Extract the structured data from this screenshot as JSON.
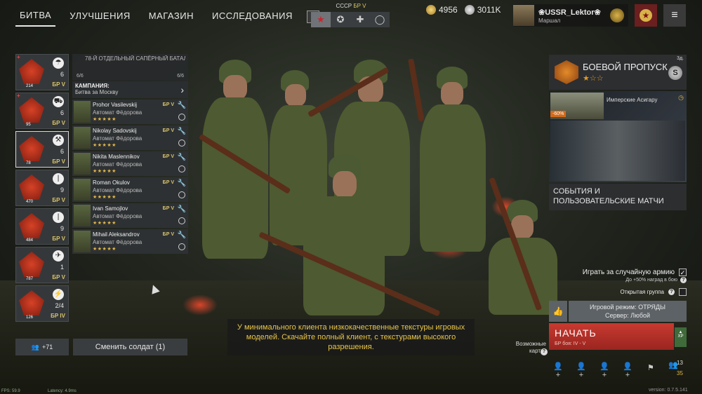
{
  "nav": {
    "tabs": [
      "БИТВА",
      "УЛУЧШЕНИЯ",
      "МАГАЗИН",
      "ИССЛЕДОВАНИЯ"
    ],
    "help": "?"
  },
  "nation": {
    "name": "СССР",
    "br": "БР V",
    "tabs": [
      "★",
      "✪",
      "✚",
      "◯"
    ]
  },
  "currency": {
    "gold": "4956",
    "silver": "3011K"
  },
  "profile": {
    "name": "❀USSR_Lektor❀",
    "rank": "Маршал"
  },
  "menu_icon": "≡",
  "squads": [
    {
      "num": "214",
      "class_icon": "parachute-icon",
      "class_glyph": "☂",
      "count": "6",
      "br": "БР V",
      "plus": "+"
    },
    {
      "num": "95",
      "class_icon": "tank-icon",
      "class_glyph": "⛟",
      "count": "6",
      "br": "БР V",
      "plus": "+"
    },
    {
      "num": "78",
      "class_icon": "engineer-icon",
      "class_glyph": "⚒",
      "count": "6",
      "br": "БР V",
      "plus": ""
    },
    {
      "num": "470",
      "class_icon": "bayonet-icon",
      "class_glyph": "|",
      "count": "9",
      "br": "БР V",
      "plus": ""
    },
    {
      "num": "484",
      "class_icon": "bayonet-icon",
      "class_glyph": "|",
      "count": "9",
      "br": "БР V",
      "plus": ""
    },
    {
      "num": "787",
      "class_icon": "pilot-icon",
      "class_glyph": "✈",
      "count": "1",
      "br": "БР V",
      "plus": ""
    },
    {
      "num": "126",
      "class_icon": "rocket-icon",
      "class_glyph": "⚡",
      "count": "2/4",
      "br": "БР IV",
      "plus": ""
    }
  ],
  "unit": {
    "name": "78-Й ОТДЕЛЬНЫЙ САПЁРНЫЙ БАТАЛ",
    "left_count": "6/6",
    "right_count": "6/6"
  },
  "campaign": {
    "label": "КАМПАНИЯ:",
    "value": "Битва за Москву"
  },
  "soldiers": [
    {
      "name": "Prohor Vasilevskij",
      "weapon": "Автомат Фёдорова",
      "stars": "★★★★★",
      "br": "БР V"
    },
    {
      "name": "Nikolay Sadovskij",
      "weapon": "Автомат Фёдорова",
      "stars": "★★★★★",
      "br": "БР V"
    },
    {
      "name": "Nikita Maslennikov",
      "weapon": "Автомат Фёдорова",
      "stars": "★★★★★",
      "br": "БР V"
    },
    {
      "name": "Roman Okulov",
      "weapon": "Автомат Фёдорова",
      "stars": "★★★★★",
      "br": "БР V"
    },
    {
      "name": "Ivan Samojlov",
      "weapon": "Автомат Фёдорова",
      "stars": "★★★★★",
      "br": "БР V"
    },
    {
      "name": "Mihail Aleksandrov",
      "weapon": "Автомат Фёдорова",
      "stars": "★★★★★",
      "br": "БР V"
    }
  ],
  "reserve": "+71",
  "change_soldier": "Сменить солдат (1)",
  "notice": "У минимального клиента низкокачественные текстуры игровых моделей. Скачайте полный клиент, с текстурами высокого разрешения.",
  "battlepass": {
    "title": "БОЕВОЙ ПРОПУСК",
    "stars": "★☆☆",
    "timer": "3д.",
    "badge": "S"
  },
  "shop": {
    "label": "Имперские Асигару",
    "discount": "-60%"
  },
  "events": "СОБЫТИЯ И ПОЛЬЗОВАТЕЛЬСКИЕ МАТЧИ",
  "options": {
    "random_army": "Играть за случайную армию",
    "random_army_checked": "✓",
    "bonus": "До +50% наград в бою",
    "open_group": "Открытая группа"
  },
  "mode": {
    "line1": "Игровой режим: ОТРЯДЫ",
    "line2": "Сервер: Любой"
  },
  "start": {
    "label": "НАЧАТЬ",
    "br": "БР боя: IV - V"
  },
  "xp": "XP",
  "cards": "Возможные карты:",
  "friends": {
    "top": "13",
    "bottom": "35"
  },
  "hud": {
    "fps": "FPS: 59.9",
    "latency": "Latency: 4.9ms"
  },
  "version": "version: 0.7.5.141"
}
